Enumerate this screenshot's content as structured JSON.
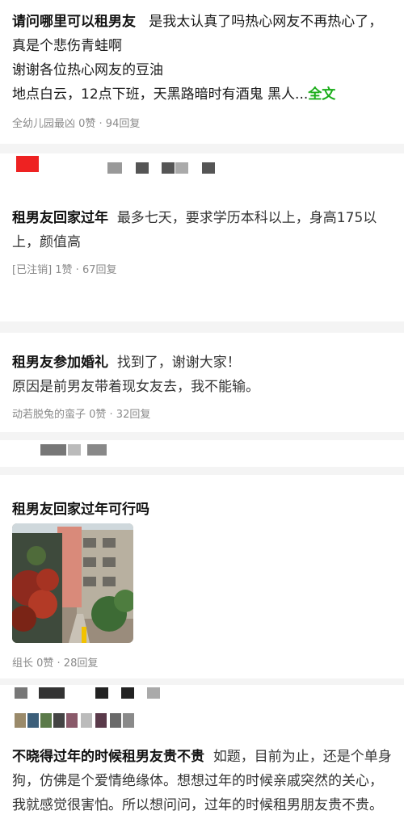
{
  "posts": [
    {
      "title": "请问哪里可以租男友",
      "lines": [
        "是我太认真了吗热心网友不再热心了，真是个悲伤青蛙啊",
        "谢谢各位热心网友的豆油",
        "地点白云，12点下班，天黑路暗时有酒鬼 黑人..."
      ],
      "more_label": "全文",
      "meta": "全幼儿园最凶 0赞 · 94回复"
    },
    {
      "title": "租男友回家过年",
      "lines": [
        "最多七天，要求学历本科以上，身高175以上，颜值高"
      ],
      "meta": "[已注销] 1赞 · 67回复"
    },
    {
      "title": "租男友参加婚礼",
      "lines": [
        "找到了，谢谢大家！",
        "原因是前男友带着现女友去，我不能输。"
      ],
      "meta": "动若脱兔的蛮子 0赞 · 32回复"
    },
    {
      "title": "租男友回家过年可行吗",
      "image": "building-street-photo",
      "meta": "组长 0赞 · 28回复"
    },
    {
      "title": "不晓得过年的时候租男友贵不贵",
      "lines": [
        "如题，目前为止，还是个单身狗，仿佛是个爱情绝缘体。想想过年的时候亲戚突然的关心，我就感觉很害怕。所以想问问，过年的时候租男朋友贵不贵。"
      ]
    }
  ],
  "colors": {
    "title": "#111111",
    "meta": "#8a8a8a",
    "accent_green": "#1aad19",
    "divider": "#f4f4f4"
  }
}
